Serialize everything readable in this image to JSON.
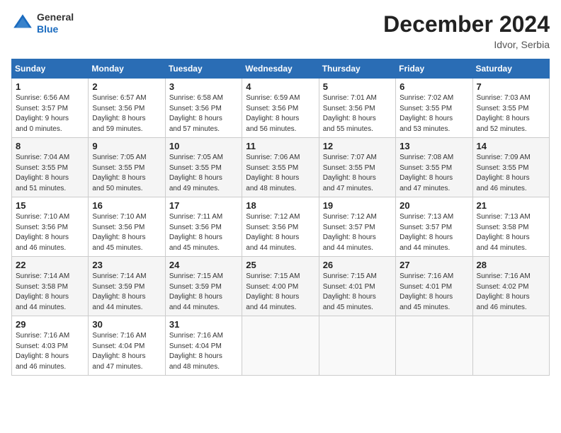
{
  "header": {
    "logo_general": "General",
    "logo_blue": "Blue",
    "main_title": "December 2024",
    "subtitle": "Idvor, Serbia"
  },
  "weekdays": [
    "Sunday",
    "Monday",
    "Tuesday",
    "Wednesday",
    "Thursday",
    "Friday",
    "Saturday"
  ],
  "weeks": [
    [
      {
        "day": "1",
        "sunrise": "6:56 AM",
        "sunset": "3:57 PM",
        "daylight": "9 hours and 0 minutes."
      },
      {
        "day": "2",
        "sunrise": "6:57 AM",
        "sunset": "3:56 PM",
        "daylight": "8 hours and 59 minutes."
      },
      {
        "day": "3",
        "sunrise": "6:58 AM",
        "sunset": "3:56 PM",
        "daylight": "8 hours and 57 minutes."
      },
      {
        "day": "4",
        "sunrise": "6:59 AM",
        "sunset": "3:56 PM",
        "daylight": "8 hours and 56 minutes."
      },
      {
        "day": "5",
        "sunrise": "7:01 AM",
        "sunset": "3:56 PM",
        "daylight": "8 hours and 55 minutes."
      },
      {
        "day": "6",
        "sunrise": "7:02 AM",
        "sunset": "3:55 PM",
        "daylight": "8 hours and 53 minutes."
      },
      {
        "day": "7",
        "sunrise": "7:03 AM",
        "sunset": "3:55 PM",
        "daylight": "8 hours and 52 minutes."
      }
    ],
    [
      {
        "day": "8",
        "sunrise": "7:04 AM",
        "sunset": "3:55 PM",
        "daylight": "8 hours and 51 minutes."
      },
      {
        "day": "9",
        "sunrise": "7:05 AM",
        "sunset": "3:55 PM",
        "daylight": "8 hours and 50 minutes."
      },
      {
        "day": "10",
        "sunrise": "7:05 AM",
        "sunset": "3:55 PM",
        "daylight": "8 hours and 49 minutes."
      },
      {
        "day": "11",
        "sunrise": "7:06 AM",
        "sunset": "3:55 PM",
        "daylight": "8 hours and 48 minutes."
      },
      {
        "day": "12",
        "sunrise": "7:07 AM",
        "sunset": "3:55 PM",
        "daylight": "8 hours and 47 minutes."
      },
      {
        "day": "13",
        "sunrise": "7:08 AM",
        "sunset": "3:55 PM",
        "daylight": "8 hours and 47 minutes."
      },
      {
        "day": "14",
        "sunrise": "7:09 AM",
        "sunset": "3:55 PM",
        "daylight": "8 hours and 46 minutes."
      }
    ],
    [
      {
        "day": "15",
        "sunrise": "7:10 AM",
        "sunset": "3:56 PM",
        "daylight": "8 hours and 46 minutes."
      },
      {
        "day": "16",
        "sunrise": "7:10 AM",
        "sunset": "3:56 PM",
        "daylight": "8 hours and 45 minutes."
      },
      {
        "day": "17",
        "sunrise": "7:11 AM",
        "sunset": "3:56 PM",
        "daylight": "8 hours and 45 minutes."
      },
      {
        "day": "18",
        "sunrise": "7:12 AM",
        "sunset": "3:56 PM",
        "daylight": "8 hours and 44 minutes."
      },
      {
        "day": "19",
        "sunrise": "7:12 AM",
        "sunset": "3:57 PM",
        "daylight": "8 hours and 44 minutes."
      },
      {
        "day": "20",
        "sunrise": "7:13 AM",
        "sunset": "3:57 PM",
        "daylight": "8 hours and 44 minutes."
      },
      {
        "day": "21",
        "sunrise": "7:13 AM",
        "sunset": "3:58 PM",
        "daylight": "8 hours and 44 minutes."
      }
    ],
    [
      {
        "day": "22",
        "sunrise": "7:14 AM",
        "sunset": "3:58 PM",
        "daylight": "8 hours and 44 minutes."
      },
      {
        "day": "23",
        "sunrise": "7:14 AM",
        "sunset": "3:59 PM",
        "daylight": "8 hours and 44 minutes."
      },
      {
        "day": "24",
        "sunrise": "7:15 AM",
        "sunset": "3:59 PM",
        "daylight": "8 hours and 44 minutes."
      },
      {
        "day": "25",
        "sunrise": "7:15 AM",
        "sunset": "4:00 PM",
        "daylight": "8 hours and 44 minutes."
      },
      {
        "day": "26",
        "sunrise": "7:15 AM",
        "sunset": "4:01 PM",
        "daylight": "8 hours and 45 minutes."
      },
      {
        "day": "27",
        "sunrise": "7:16 AM",
        "sunset": "4:01 PM",
        "daylight": "8 hours and 45 minutes."
      },
      {
        "day": "28",
        "sunrise": "7:16 AM",
        "sunset": "4:02 PM",
        "daylight": "8 hours and 46 minutes."
      }
    ],
    [
      {
        "day": "29",
        "sunrise": "7:16 AM",
        "sunset": "4:03 PM",
        "daylight": "8 hours and 46 minutes."
      },
      {
        "day": "30",
        "sunrise": "7:16 AM",
        "sunset": "4:04 PM",
        "daylight": "8 hours and 47 minutes."
      },
      {
        "day": "31",
        "sunrise": "7:16 AM",
        "sunset": "4:04 PM",
        "daylight": "8 hours and 48 minutes."
      },
      null,
      null,
      null,
      null
    ]
  ],
  "labels": {
    "sunrise": "Sunrise:",
    "sunset": "Sunset:",
    "daylight": "Daylight hours"
  }
}
